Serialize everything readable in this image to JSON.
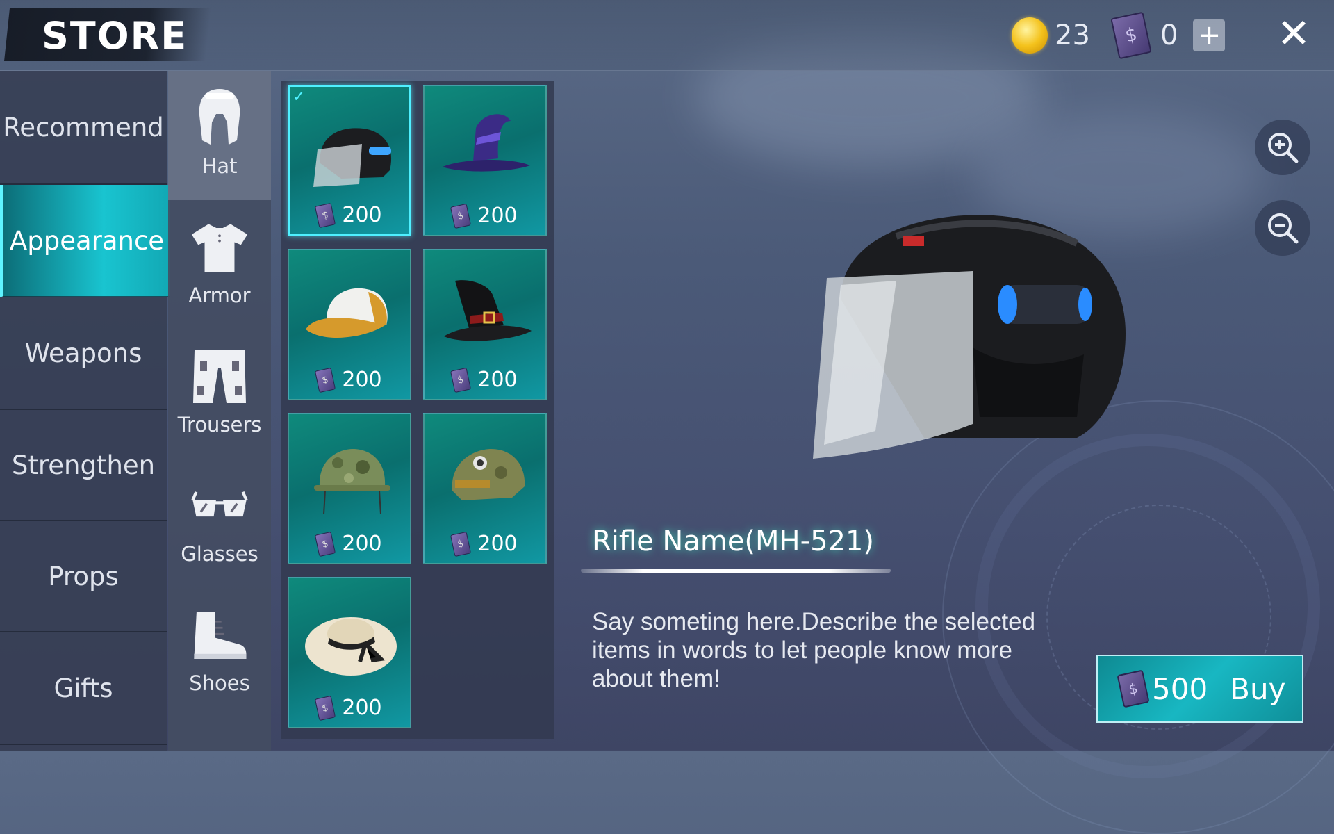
{
  "header": {
    "title": "STORE",
    "gold_amount": "23",
    "ticket_amount": "0",
    "add_label": "+",
    "close_label": "✕"
  },
  "categories": [
    {
      "label": "Recommend",
      "active": false
    },
    {
      "label": "Appearance",
      "active": true
    },
    {
      "label": "Weapons",
      "active": false
    },
    {
      "label": "Strengthen",
      "active": false
    },
    {
      "label": "Props",
      "active": false
    },
    {
      "label": "Gifts",
      "active": false
    }
  ],
  "subcategories": [
    {
      "label": "Hat",
      "icon": "spartan-helmet-icon",
      "active": true
    },
    {
      "label": "Armor",
      "icon": "tshirt-icon",
      "active": false
    },
    {
      "label": "Trousers",
      "icon": "trousers-icon",
      "active": false
    },
    {
      "label": "Glasses",
      "icon": "glasses-icon",
      "active": false
    },
    {
      "label": "Shoes",
      "icon": "boot-icon",
      "active": false
    }
  ],
  "items": [
    {
      "name": "motorcycle-helmet",
      "price": "200",
      "selected": true
    },
    {
      "name": "purple-witch-hat",
      "price": "200",
      "selected": false
    },
    {
      "name": "baseball-cap",
      "price": "200",
      "selected": false
    },
    {
      "name": "black-witch-hat",
      "price": "200",
      "selected": false
    },
    {
      "name": "camo-helmet",
      "price": "200",
      "selected": false
    },
    {
      "name": "army-helmet",
      "price": "200",
      "selected": false
    },
    {
      "name": "sun-hat",
      "price": "200",
      "selected": false
    }
  ],
  "detail": {
    "name": "Rifle Name(MH-521)",
    "description": "Say someting here.Describe the selected items in words to let people know more about them!",
    "price": "500",
    "buy_label": "Buy"
  },
  "colors": {
    "accent": "#19c4d0",
    "item_bg": "#0a6f6e",
    "selected_border": "#4ff0ff"
  }
}
